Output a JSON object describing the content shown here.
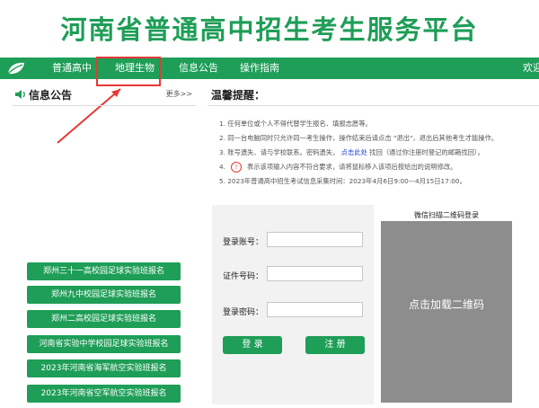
{
  "header": {
    "title": "河南省普通高中招生考生服务平台"
  },
  "nav": {
    "items": [
      {
        "label": "普通高中"
      },
      {
        "label": "地理生物"
      },
      {
        "label": "信息公告"
      },
      {
        "label": "操作指南"
      }
    ],
    "welcome": "欢迎"
  },
  "left_panel": {
    "title": "信息公告",
    "more": "更多>>"
  },
  "notice": {
    "title": "温馨提醒：",
    "items": [
      "1. 任何单位或个人不得代替学生报名、填报志愿等。",
      "2. 同一台电脑同时只允许同一考生操作，操作结束后请点击 \"退出\"，退出后其他考生才能操作。",
      "3. 账号遗失、请与学校联系。密码遗失，",
      "4.",
      "5. 2023年普通高中招生考试信息采集时间：2023年4月6日9:00—4月15日17:00。"
    ],
    "item3_link": "点击此处",
    "item3_tail": "找回（通过你注册时登记的邮箱找回）。",
    "item4_text": "表示该项输入内容不符合要求，请将鼠标移入该项后按给出的说明修改。",
    "warn_symbol": "!"
  },
  "login": {
    "account_label": "登录账号：",
    "id_label": "证件号码：",
    "password_label": "登录密码：",
    "login_button": "登 录",
    "register_button": "注 册"
  },
  "qr": {
    "title": "微信扫描二维码登录",
    "placeholder": "点击加载二维码"
  },
  "signups": [
    "郑州三十一高校园足球实验班报名",
    "郑州九中校园足球实验班报名",
    "郑州二高校园足球实验班报名",
    "河南省实验中学校园足球实验班报名",
    "2023年河南省海军航空实验班报名",
    "2023年河南省空军航空实验班报名"
  ],
  "colors": {
    "brand": "#1e9e57",
    "highlight": "#e53935",
    "link": "#1f3fcf"
  }
}
